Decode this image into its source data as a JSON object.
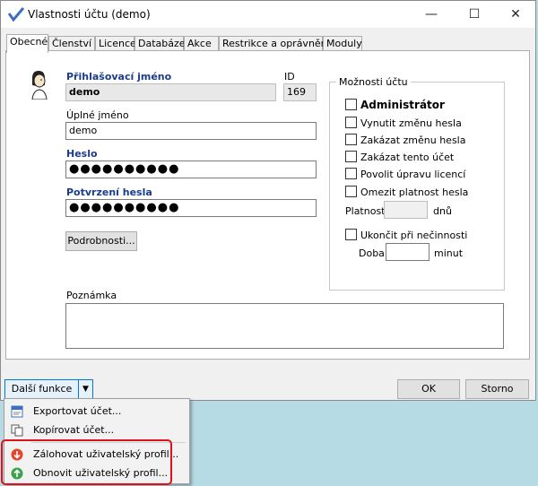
{
  "window": {
    "title": "Vlastnosti účtu (demo)",
    "minimize_glyph": "—",
    "maximize_glyph": "☐",
    "close_glyph": "✕"
  },
  "tabs": [
    {
      "label": "Obecné",
      "active": true
    },
    {
      "label": "Členství"
    },
    {
      "label": "Licence"
    },
    {
      "label": "Databáze"
    },
    {
      "label": "Akce"
    },
    {
      "label": "Restrikce a oprávnění"
    },
    {
      "label": "Moduly"
    }
  ],
  "general": {
    "login_label": "Přihlašovací jméno",
    "login_value": "demo",
    "id_label": "ID",
    "id_value": "169",
    "fullname_label": "Úplné jméno",
    "fullname_value": "demo",
    "password_label": "Heslo",
    "password_value": "●●●●●●●●●●",
    "confirm_label": "Potvrzení hesla",
    "confirm_value": "●●●●●●●●●●",
    "details_button": "Podrobnosti...",
    "note_label": "Poznámka",
    "note_value": ""
  },
  "options": {
    "title": "Možnosti účtu",
    "checkboxes": [
      {
        "label": "Administrátor",
        "checked": false
      },
      {
        "label": "Vynutit změnu hesla",
        "checked": false
      },
      {
        "label": "Zakázat změnu hesla",
        "checked": false
      },
      {
        "label": "Zakázat tento účet",
        "checked": false
      },
      {
        "label": "Povolit úpravu licencí",
        "checked": false
      },
      {
        "label": "Omezit platnost hesla",
        "checked": false
      }
    ],
    "validity_label": "Platnost",
    "validity_value": "",
    "validity_unit": "dnů",
    "inactivity_label": "Ukončit při nečinnosti",
    "duration_label": "Doba",
    "duration_value": "",
    "duration_unit": "minut"
  },
  "footer": {
    "more_functions": "Další funkce",
    "dropdown_glyph": "▼",
    "ok": "OK",
    "cancel": "Storno"
  },
  "menu": {
    "items": [
      {
        "label": "Exportovat účet...",
        "icon": "export-icon"
      },
      {
        "label": "Kopírovat účet...",
        "icon": "copy-icon"
      },
      {
        "label": "Zálohovat uživatelský profil...",
        "icon": "backup-icon"
      },
      {
        "label": "Obnovit uživatelský profil...",
        "icon": "restore-icon"
      }
    ]
  },
  "colors": {
    "accent_label": "#1a3c8c",
    "highlight": "#e0111b",
    "backup_icon": "#e8442b",
    "restore_icon": "#3aa24a"
  }
}
